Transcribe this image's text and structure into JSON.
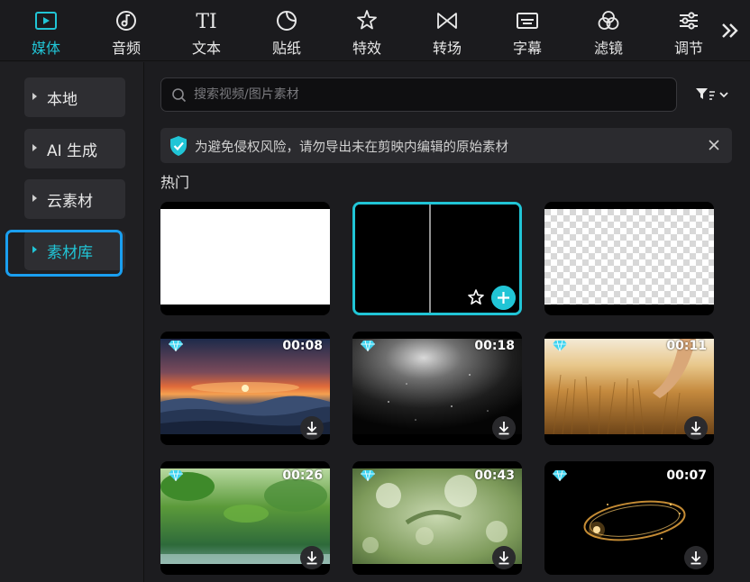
{
  "toolbar": {
    "tabs": [
      {
        "label": "媒体",
        "icon": "media-icon",
        "active": true
      },
      {
        "label": "音频",
        "icon": "audio-icon"
      },
      {
        "label": "文本",
        "icon": "text-icon"
      },
      {
        "label": "贴纸",
        "icon": "sticker-icon"
      },
      {
        "label": "特效",
        "icon": "effects-icon"
      },
      {
        "label": "转场",
        "icon": "transition-icon"
      },
      {
        "label": "字幕",
        "icon": "subtitle-icon"
      },
      {
        "label": "滤镜",
        "icon": "filter-icon"
      },
      {
        "label": "调节",
        "icon": "adjust-icon"
      }
    ],
    "more_icon": "double-chevron-right-icon"
  },
  "sidebar": {
    "items": [
      {
        "label": "本地"
      },
      {
        "label": "AI 生成"
      },
      {
        "label": "云素材"
      },
      {
        "label": "素材库",
        "active": true
      }
    ]
  },
  "search": {
    "placeholder": "搜索视频/图片素材"
  },
  "notice": {
    "text": "为避免侵权风险，请勿导出未在剪映内编辑的原始素材"
  },
  "section": {
    "title": "热门"
  },
  "cards": [
    {
      "type": "white"
    },
    {
      "type": "black-split",
      "selected": true
    },
    {
      "type": "transparent"
    },
    {
      "type": "sunset",
      "duration": "00:08"
    },
    {
      "type": "smoke",
      "duration": "00:18"
    },
    {
      "type": "wheat",
      "duration": "00:11"
    },
    {
      "type": "leaves",
      "duration": "00:26"
    },
    {
      "type": "bokeh",
      "duration": "00:43"
    },
    {
      "type": "sparkle",
      "duration": "00:07"
    }
  ],
  "colors": {
    "accent": "#21c5d6",
    "highlight": "#1a9ff0",
    "premium": "#3fd4f0"
  }
}
